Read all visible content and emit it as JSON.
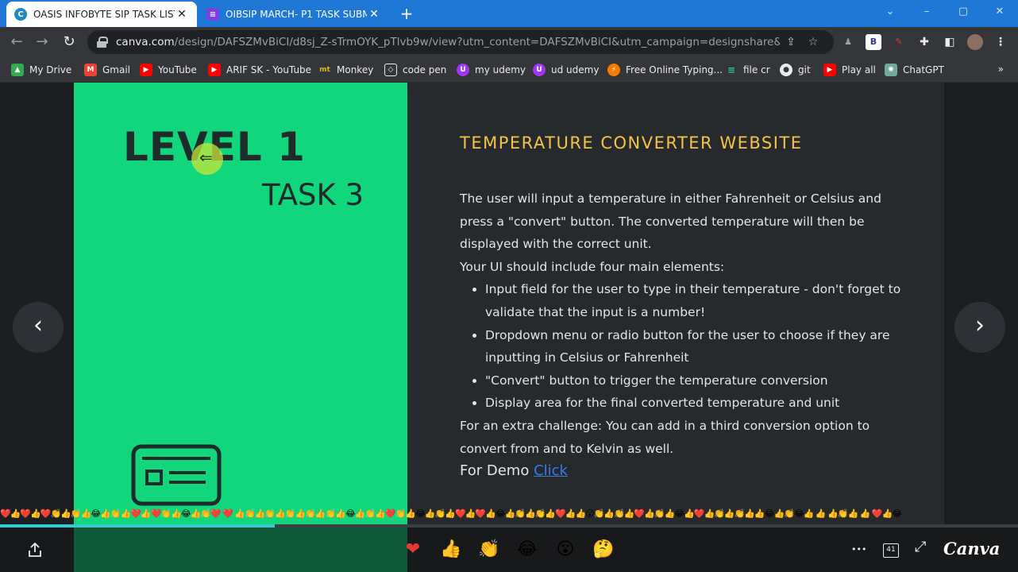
{
  "browser": {
    "tabs": [
      {
        "title": "OASIS INFOBYTE SIP TASK LIST",
        "active": true,
        "icon": "canva-favicon"
      },
      {
        "title": "OIBSIP MARCH- P1 TASK SUBM",
        "active": false,
        "icon": "forms-favicon"
      }
    ],
    "new_tab": "+",
    "url_host": "canva.com",
    "url_path": "/design/DAFSZMvBiCI/d8sj_Z-sTrmOYK_pTlvb9w/view?utm_content=DAFSZMvBiCI&utm_campaign=designshare&utm_me...",
    "bookmarks": [
      {
        "label": "My Drive",
        "icon": "drive-icon",
        "color": "#34a853"
      },
      {
        "label": "Gmail",
        "icon": "gmail-icon",
        "color": "#ea4335"
      },
      {
        "label": "YouTube",
        "icon": "youtube-icon",
        "color": "#ff0000"
      },
      {
        "label": "ARIF SK - YouTube",
        "icon": "youtube-icon",
        "color": "#ff0000"
      },
      {
        "label": "Monkey",
        "icon": "monkeytype-icon",
        "color": "#e2b714"
      },
      {
        "label": "code pen",
        "icon": "codepen-icon",
        "color": "#e8eaed"
      },
      {
        "label": "my udemy",
        "icon": "udemy-icon",
        "color": "#a435f0"
      },
      {
        "label": "ud udemy",
        "icon": "udemy-icon",
        "color": "#a435f0"
      },
      {
        "label": "Free Online Typing...",
        "icon": "typing-icon",
        "color": "#f57c00"
      },
      {
        "label": "file cr",
        "icon": "filecr-icon",
        "color": "#2bc48a"
      },
      {
        "label": "git",
        "icon": "github-icon",
        "color": "#e8eaed"
      },
      {
        "label": "Play all",
        "icon": "youtube-icon",
        "color": "#ff0000"
      },
      {
        "label": "ChatGPT",
        "icon": "chatgpt-icon",
        "color": "#74aa9c"
      }
    ],
    "bookmarks_more": "»"
  },
  "slide": {
    "level": "LEVEL 1",
    "task": "TASK 3",
    "title": "TEMPERATURE CONVERTER WEBSITE",
    "intro": "The user will input a temperature in either Fahrenheit or Celsius and press a \"convert\" button. The converted temperature will then be displayed with the correct unit.",
    "ui_heading": "Your UI should include four main elements:",
    "bullets": [
      "Input field for the user to type in their temperature - don't forget to validate that the input is a number!",
      "Dropdown menu or radio button for the user to choose if they are inputting in Celsius or Fahrenheit",
      "\"Convert\" button to trigger the temperature conversion",
      "Display area for the final converted temperature and unit"
    ],
    "extra": "For an extra challenge: You can add in a third conversion option to convert from and to Kelvin as well.",
    "demo_label": "For Demo",
    "demo_link": "Click"
  },
  "player": {
    "progress": 0.27,
    "reactions": [
      "❤",
      "👍",
      "👏",
      "😂",
      "😮",
      "🤔"
    ],
    "page_count": "41",
    "brand": "Canva",
    "prev": "‹",
    "next": "›",
    "more": "•••",
    "fullscreen": "⤢"
  },
  "colors": {
    "accent_green": "#12d67c",
    "title_yellow": "#f6c344",
    "link_blue": "#3b7be6",
    "tab_blue": "#1f78d6"
  }
}
